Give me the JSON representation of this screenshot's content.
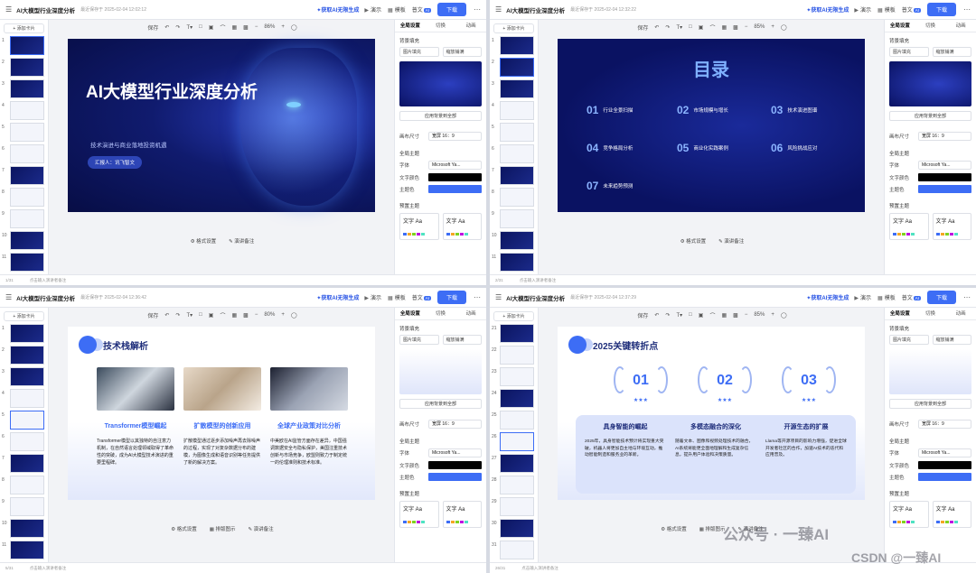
{
  "app": {
    "doc_title": "AI大模型行业深度分析",
    "ai_label": "获取AI无限生成",
    "present_label": "演示",
    "template_label": "模板",
    "flagship_label": "普文",
    "flagship_badge": "AI",
    "download_label": "下载",
    "more_icon": "ellipsis-icon",
    "add_slide_label": "添加卡片",
    "zoom": "86%",
    "save_label": "保存"
  },
  "quadrants": [
    {
      "save_time": "最近保存于 2025-02-04 12:02:12",
      "slide_count": "1/31",
      "notes": "点击输入演讲者备注"
    },
    {
      "save_time": "最近保存于 2025-02-04 12:32:22",
      "slide_count": "2/31",
      "notes": "点击输入演讲者备注",
      "zoom": "85%"
    },
    {
      "save_time": "最近保存于 2025-02-04 12:36:42",
      "slide_count": "5/31",
      "notes": "点击输入演讲者备注",
      "zoom": "80%"
    },
    {
      "save_time": "最近保存于 2025-02-04 12:37:29",
      "slide_count": "26/31",
      "notes": "点击输入演讲者备注",
      "zoom": "85%"
    }
  ],
  "right_panel": {
    "tabs": [
      "全局设置",
      "切换",
      "动画"
    ],
    "bg_fill_label": "背景填充",
    "fill_type": "图片填充",
    "fill_mode": "缩放铺满",
    "apply_all": "应用背景到全部",
    "canvas_size_label": "画布尺寸",
    "canvas_size": "宽屏 16：9",
    "global_theme_label": "全局主题",
    "font_label": "字体",
    "font_value": "Microsoft Ya...",
    "text_color_label": "文字颜色",
    "theme_color_label": "主题色",
    "preset_theme_label": "预置主题",
    "theme_sample": "文字 Aa"
  },
  "bottom_controls": {
    "format": "格式设置",
    "layout": "排版图示",
    "notes": "演讲备注"
  },
  "slide1": {
    "title": "AI大模型行业深度分析",
    "subtitle": "技术演进与商业落地投资机遇",
    "presenter": "汇报人：讯飞智文"
  },
  "slide2": {
    "title": "目录",
    "items": [
      {
        "num": "01",
        "text": "行业全景扫描"
      },
      {
        "num": "02",
        "text": "市场规模与增长"
      },
      {
        "num": "03",
        "text": "技术演进图谱"
      },
      {
        "num": "04",
        "text": "竞争格局分析"
      },
      {
        "num": "05",
        "text": "商业化实践案例"
      },
      {
        "num": "06",
        "text": "风险挑战应对"
      },
      {
        "num": "07",
        "text": "未来趋势预测"
      }
    ]
  },
  "slide3": {
    "title": "技术栈解析",
    "cols": [
      {
        "title": "Transformer模型崛起",
        "body": "Transformer模型以其独特的自注意力机制，在自然语言处理领域取得了革命性的突破，成为AI大模型技术演进的重要里程碑。"
      },
      {
        "title": "扩散模型的创新应用",
        "body": "扩散模型通过逐步添加噪声再去除噪声的过程，实现了对复杂数据分布的建模，为图像生成和语音识别等任务提供了新的解决方案。"
      },
      {
        "title": "全球产业政策对比分析",
        "body": "中美欧在AI监管方面存在差异，中国强调数据安全与隐私保护，美国注重技术创新与市场竞争，欧盟则致力于制定统一的伦理准则和技术标准。"
      }
    ]
  },
  "slide4": {
    "title": "2025关键转折点",
    "awards": [
      "01",
      "02",
      "03"
    ],
    "stars": "★★★",
    "cols": [
      {
        "title": "具身智能的崛起",
        "body": "2025年，具身智能技术预计将实现重大突破，机器人将更加自主地与环境互动，推动智能制造和服务业的革新。"
      },
      {
        "title": "多模态融合的深化",
        "body": "随着文本、图像和视频处理技术的融合，AI系统将能更全面地理解和生成复杂信息，提升用户体验和决策质量。"
      },
      {
        "title": "开源生态的扩展",
        "body": "Llama等开源项目的影响力增强，促进全球开发者社区的合作，加速AI技术的迭代和应用普及。"
      }
    ]
  },
  "watermark": {
    "wechat": "公众号 · 一臻AI",
    "csdn": "CSDN @一臻AI"
  },
  "colors": {
    "accent": "#3d6df5",
    "dark_navy": "#0b1560",
    "text_black": "#000000"
  }
}
